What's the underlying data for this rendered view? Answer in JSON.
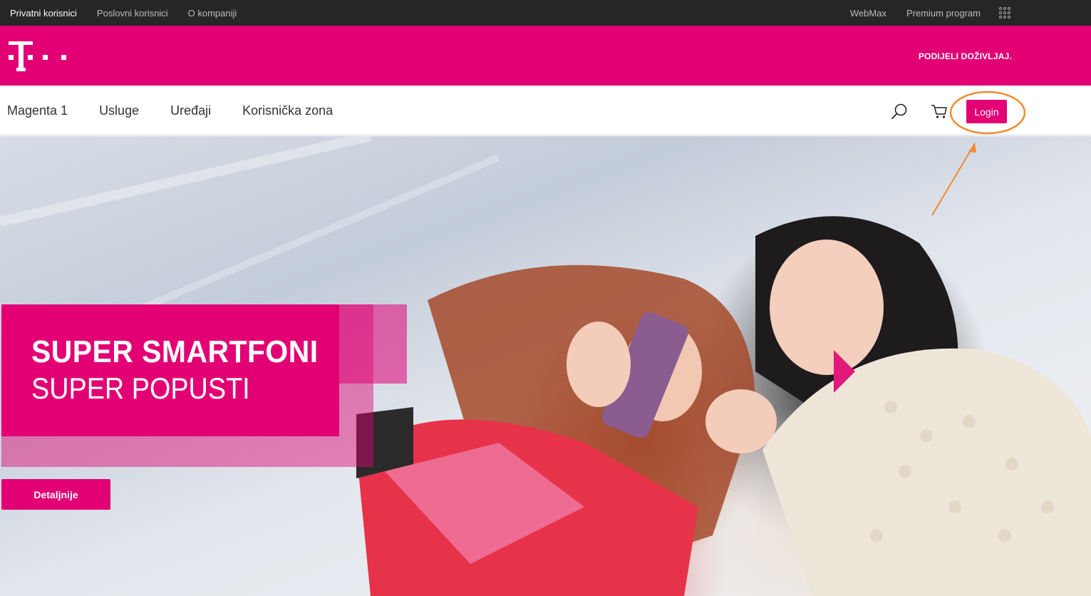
{
  "topbar": {
    "left_links": [
      "Privatni korisnici",
      "Poslovni korisnici",
      "O kompaniji"
    ],
    "active": "Privatni korisnici",
    "right_links": [
      "WebMax",
      "Premium program"
    ],
    "apps_icon": "grid-apps-icon"
  },
  "brand": {
    "logo": "telekom-t-logo",
    "tagline": "PODIJELI DOŽIVLJAJ.",
    "color": "#e20074"
  },
  "nav": {
    "items": [
      "Magenta 1",
      "Usluge",
      "Uređaji",
      "Korisnička zona"
    ],
    "search_icon": "search-icon",
    "cart_icon": "cart-icon",
    "login_label": "Login"
  },
  "hero": {
    "title": "SUPER SMARTFONI",
    "subtitle": "SUPER POPUSTI",
    "cta_label": "Detaljnije"
  },
  "annotation": {
    "color": "#f08a30",
    "target": "Login"
  }
}
